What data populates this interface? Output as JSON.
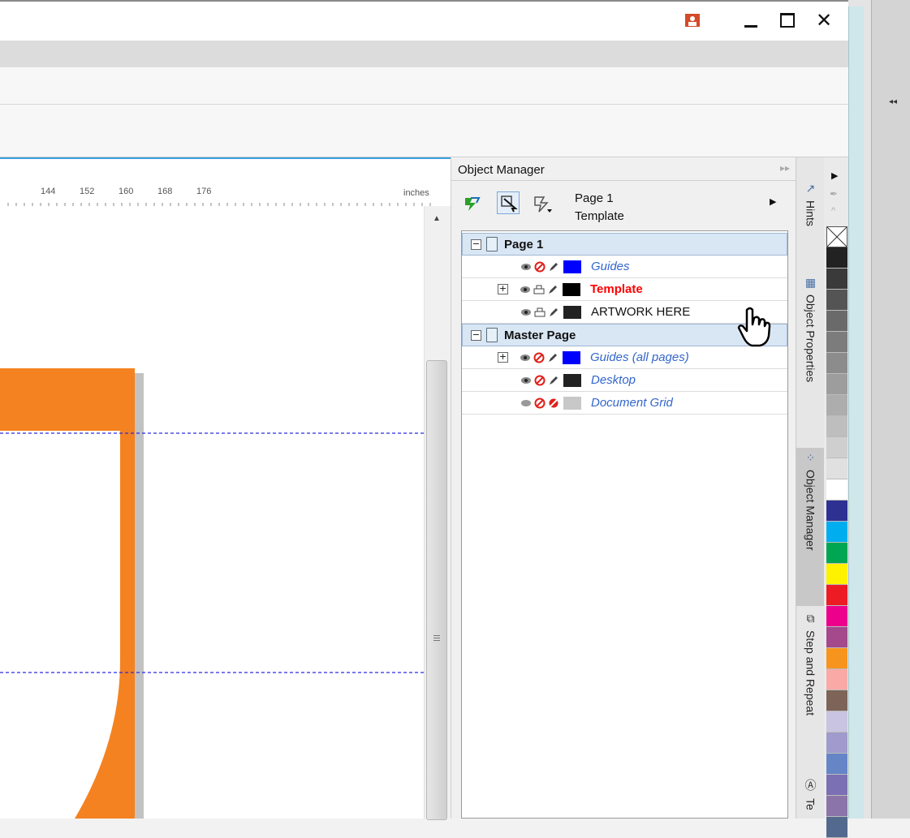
{
  "window": {
    "minimize_glyph": "▁",
    "maximize_glyph": "☐",
    "close_glyph": "✕",
    "user_icon": "user-icon"
  },
  "ruler": {
    "ticks": [
      "144",
      "152",
      "160",
      "168",
      "176"
    ],
    "unit": "inches"
  },
  "docker": {
    "title": "Object Manager",
    "current_page": "Page 1",
    "current_layer": "Template",
    "toolbar_icons": [
      "show-object-properties-icon",
      "edit-across-layers-icon",
      "layer-manager-view-icon"
    ],
    "pages": [
      {
        "name": "Page 1",
        "layers": [
          {
            "name": "Guides",
            "style": "italic-blue",
            "expandable": false,
            "color": "#0000ff"
          },
          {
            "name": "Template",
            "style": "bold-red",
            "expandable": true,
            "color": "#000000"
          },
          {
            "name": "ARTWORK HERE",
            "style": "normal",
            "expandable": false,
            "color": "#222222"
          }
        ]
      },
      {
        "name": "Master Page",
        "layers": [
          {
            "name": "Guides (all pages)",
            "style": "italic-blue",
            "expandable": true,
            "color": "#0000ff"
          },
          {
            "name": "Desktop",
            "style": "italic-blue",
            "expandable": false,
            "color": "#222222"
          },
          {
            "name": "Document Grid",
            "style": "italic-blue",
            "expandable": false,
            "color": "#c8c8c8"
          }
        ]
      }
    ]
  },
  "tabs": [
    "Hints",
    "Object Properties",
    "Object Manager",
    "Step and Repeat",
    "Te"
  ],
  "palette": [
    "#ffffff",
    "#222222",
    "#3a3a3a",
    "#545454",
    "#6a6a6a",
    "#7c7c7c",
    "#8c8c8c",
    "#9d9d9d",
    "#adadad",
    "#bebebe",
    "#cfcfcf",
    "#e0e0e0",
    "#ffffff",
    "#2e3192",
    "#00aeef",
    "#00a651",
    "#fff200",
    "#ed1c24",
    "#ec008c",
    "#a3498c",
    "#f7941d",
    "#f9aaa6",
    "#7d6458",
    "#c9c4e0",
    "#a09bcc",
    "#6685c7",
    "#7a70b3",
    "#8b75a8",
    "#536a8e"
  ],
  "colors": {
    "accent_orange": "#f58220",
    "guide_blue": "#0000ff",
    "template_red": "#ff0000",
    "italic_blue": "#3366cc"
  }
}
